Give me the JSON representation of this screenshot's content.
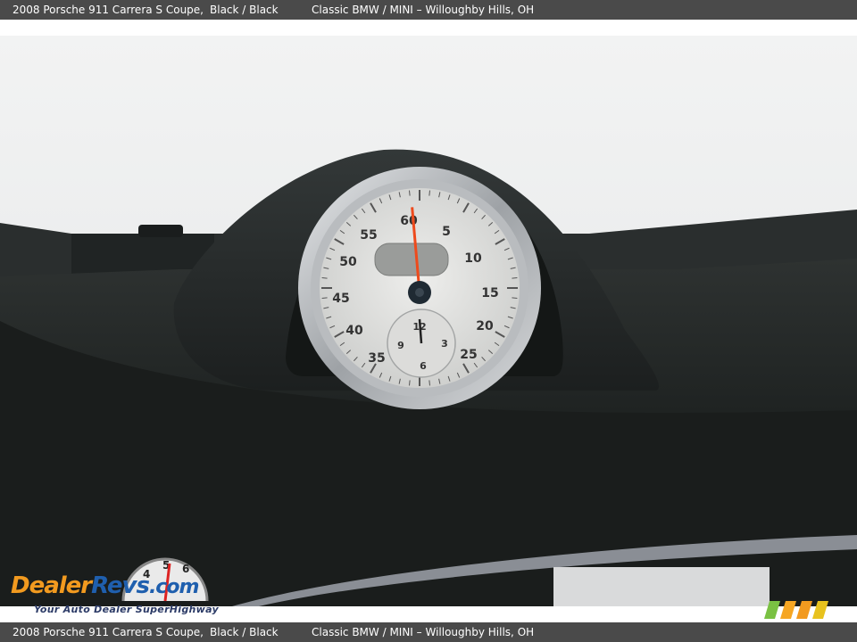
{
  "header": {
    "vehicle": "2008 Porsche 911 Carrera S Coupe,",
    "colors": "Black / Black",
    "dealer": "Classic BMW / MINI – Willoughby Hills, OH"
  },
  "footer": {
    "vehicle": "2008 Porsche 911 Carrera S Coupe,",
    "colors": "Black / Black",
    "dealer": "Classic BMW / MINI – Willoughby Hills, OH"
  },
  "watermark": {
    "brand_part1": "Dealer",
    "brand_part2": "Revs",
    "brand_part3": ".com",
    "tagline": "Your Auto Dealer SuperHighway",
    "gauge_digits": [
      "4",
      "5",
      "6"
    ]
  },
  "stopwatch": {
    "minute_labels": [
      "60",
      "5",
      "10",
      "15",
      "20",
      "25",
      "35",
      "40",
      "45",
      "50",
      "55"
    ],
    "subdial_labels": [
      "12",
      "3",
      "6",
      "9"
    ],
    "hand_angle_deg": 355
  },
  "colors": {
    "bar": "#4a4a4a",
    "dash": "#1f2322",
    "pod": "#262a2a",
    "bezel": "#b8bcc0",
    "face": "#e6e6e4",
    "hand": "#ee4a1c",
    "logo_orange": "#f29a1f",
    "logo_blue": "#1f5fae"
  }
}
